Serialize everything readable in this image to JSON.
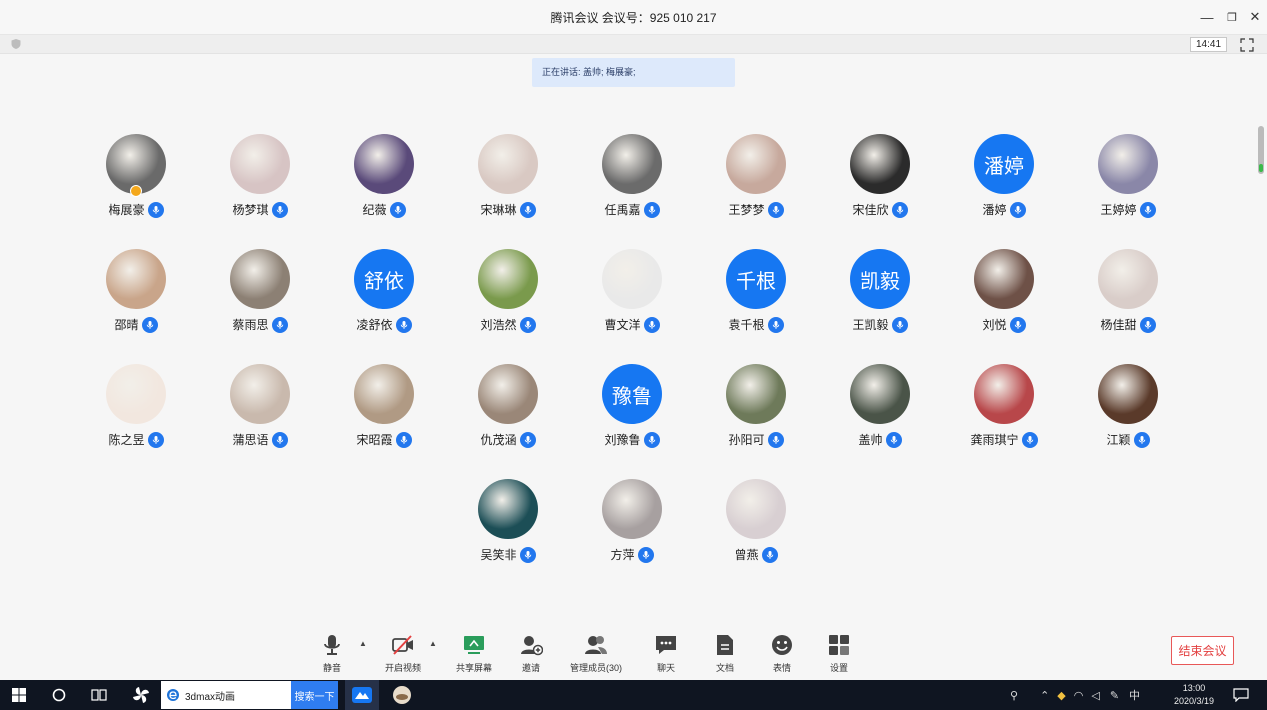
{
  "window": {
    "title": "腾讯会议 会议号：925 010 217",
    "min_glyph": "—",
    "restore_glyph": "❐",
    "close_glyph": "✕"
  },
  "infobar": {
    "time": "14:41"
  },
  "speaking": {
    "text": "正在讲话: 盖帅; 梅展豪;"
  },
  "participants": [
    {
      "name": "梅展豪",
      "avatar": "photo",
      "color": "#6a6a6a",
      "host": true
    },
    {
      "name": "杨梦琪",
      "avatar": "photo",
      "color": "#d7c4c4"
    },
    {
      "name": "纪薇",
      "avatar": "photo",
      "color": "#5a4a7a"
    },
    {
      "name": "宋琳琳",
      "avatar": "photo",
      "color": "#d9c9c3"
    },
    {
      "name": "任禹嘉",
      "avatar": "photo",
      "color": "#6b6b6b"
    },
    {
      "name": "王梦梦",
      "avatar": "photo",
      "color": "#c7a99d"
    },
    {
      "name": "宋佳欣",
      "avatar": "photo",
      "color": "#2b2b2b"
    },
    {
      "name": "潘婷",
      "avatar": "text",
      "text": "潘婷"
    },
    {
      "name": "王婷婷",
      "avatar": "photo",
      "color": "#8a87a8"
    },
    {
      "name": "邵晴",
      "avatar": "photo",
      "color": "#c9a58a"
    },
    {
      "name": "蔡雨思",
      "avatar": "photo",
      "color": "#8c8074"
    },
    {
      "name": "凌舒依",
      "avatar": "text",
      "text": "舒依"
    },
    {
      "name": "刘浩然",
      "avatar": "photo",
      "color": "#7a9a4c"
    },
    {
      "name": "曹文洋",
      "avatar": "photo",
      "color": "#e9e9e9"
    },
    {
      "name": "袁千根",
      "avatar": "text",
      "text": "千根"
    },
    {
      "name": "王凯毅",
      "avatar": "text",
      "text": "凯毅"
    },
    {
      "name": "刘悦",
      "avatar": "photo",
      "color": "#6e5147"
    },
    {
      "name": "杨佳甜",
      "avatar": "photo",
      "color": "#d9cdc9"
    },
    {
      "name": "陈之昱",
      "avatar": "photo",
      "color": "#f2e7df"
    },
    {
      "name": "蒲思语",
      "avatar": "photo",
      "color": "#c9b9ad"
    },
    {
      "name": "宋昭霞",
      "avatar": "photo",
      "color": "#b09a84"
    },
    {
      "name": "仇茂涵",
      "avatar": "photo",
      "color": "#9a8778"
    },
    {
      "name": "刘豫鲁",
      "avatar": "text",
      "text": "豫鲁"
    },
    {
      "name": "孙阳可",
      "avatar": "photo",
      "color": "#6e7a5a"
    },
    {
      "name": "盖帅",
      "avatar": "photo",
      "color": "#4a5448",
      "speaking": true
    },
    {
      "name": "龚雨琪宁",
      "avatar": "photo",
      "color": "#b8474a"
    },
    {
      "name": "江颖",
      "avatar": "photo",
      "color": "#5a3a2a"
    },
    {
      "name": "吴笑非",
      "avatar": "photo",
      "color": "#1c4e56"
    },
    {
      "name": "方萍",
      "avatar": "photo",
      "color": "#a7a0a0"
    },
    {
      "name": "曾燕",
      "avatar": "photo",
      "color": "#d8cfd2"
    }
  ],
  "toolbar": {
    "mute": "静音",
    "video": "开启视频",
    "share": "共享屏幕",
    "invite": "邀请",
    "members": "管理成员(30)",
    "chat": "聊天",
    "docs": "文档",
    "emoji": "表情",
    "settings": "设置",
    "end": "结束会议"
  },
  "taskbar": {
    "search_text": "3dmax动画",
    "search_button": "搜索一下",
    "ime": "中",
    "time": "13:00",
    "date": "2020/3/19"
  },
  "colors": {
    "accent": "#1677f2",
    "end_red": "#e34040",
    "share_green": "#2a9d5b"
  }
}
